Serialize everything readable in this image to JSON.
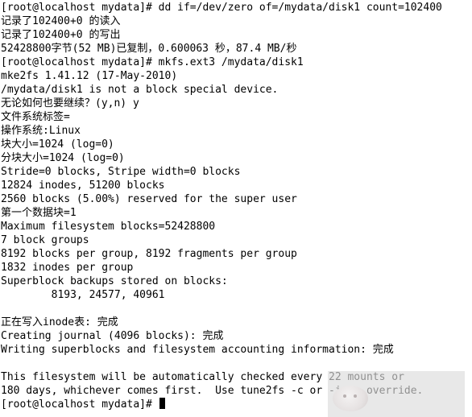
{
  "terminal": {
    "lines": [
      "[root@localhost mydata]# dd if=/dev/zero of=/mydata/disk1 count=102400",
      "记录了102400+0 的读入",
      "记录了102400+0 的写出",
      "52428800字节(52 MB)已复制，0.600063 秒，87.4 MB/秒",
      "[root@localhost mydata]# mkfs.ext3 /mydata/disk1",
      "mke2fs 1.41.12 (17-May-2010)",
      "/mydata/disk1 is not a block special device.",
      "无论如何也要继续？(y,n) y",
      "文件系统标签=",
      "操作系统:Linux",
      "块大小=1024 (log=0)",
      "分块大小=1024 (log=0)",
      "Stride=0 blocks, Stripe width=0 blocks",
      "12824 inodes, 51200 blocks",
      "2560 blocks (5.00%) reserved for the super user",
      "第一个数据块=1",
      "Maximum filesystem blocks=52428800",
      "7 block groups",
      "8192 blocks per group, 8192 fragments per group",
      "1832 inodes per group",
      "Superblock backups stored on blocks:",
      "        8193, 24577, 40961",
      "",
      "正在写入inode表: 完成",
      "Creating journal (4096 blocks): 完成",
      "Writing superblocks and filesystem accounting information: 完成",
      "",
      "This filesystem will be automatically checked every 22 mounts or",
      "180 days, whichever comes first.  Use tune2fs -c or -i to override."
    ],
    "prompt": "[root@localhost mydata]# "
  }
}
